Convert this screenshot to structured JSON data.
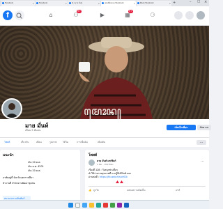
{
  "browser": {
    "tabs": [
      {
        "label": "Facebook",
        "active": false
      },
      {
        "label": "Facebook",
        "active": false
      },
      {
        "label": "(1) นาย มั่นท์",
        "active": false
      },
      {
        "label": "เพจเพื่อนของ Facebook",
        "active": true
      },
      {
        "label": "ติดต่อ Facebook",
        "active": false
      }
    ]
  },
  "fb": {
    "badges": {
      "notifications": "9+",
      "messages": "9+"
    }
  },
  "profile": {
    "name": "มาย มั่นท์",
    "friends": "เพื่อน 5 พันคน",
    "add_friend_button": "เพิ่มเป็นเพื่อน",
    "message_button": "ข้อความ"
  },
  "profile_tabs": [
    "โพสต์",
    "เกี่ยวกับ",
    "เพื่อน",
    "รูปภาพ",
    "วิดีโอ",
    "การเช็คอิน",
    "เพิ่มเติม"
  ],
  "intro": {
    "title": "แนะนำ",
    "lines": [
      "เกิด 20 ค.ศ.",
      "เกิด ค.ศ. 4201",
      "เกิด 20 ค.ศ.",
      "อาศัยอยู่ที่ จังหวัดนครราชสีมา",
      "ทำงานที่ สำนักงานพัฒนาชุมชน"
    ],
    "extra": "สถานะความสัมพันธ์"
  },
  "posts": {
    "title": "โพสต์",
    "author": "มาย มั่นท์ แชร์ลิงก์",
    "time": "1 ชม. · สาธารณะ",
    "body_1": "เรื่องที่ 128 : วิ่งสนุกช่วงสั้นๆ",
    "body_2": "ทำให้ร่างกายสุขภาพดี และรู้สึกดีกับตัวเอง",
    "link_label": "อ่านต่อที่ : ",
    "link": "https://fb.watch/s/xM2k",
    "like_label": "ถูกใจ",
    "comment_label": "แสดงความคิดเห็น",
    "share_label": "แชร์"
  },
  "colors": {
    "primary": "#1877f2",
    "badge": "#e41e3f"
  }
}
